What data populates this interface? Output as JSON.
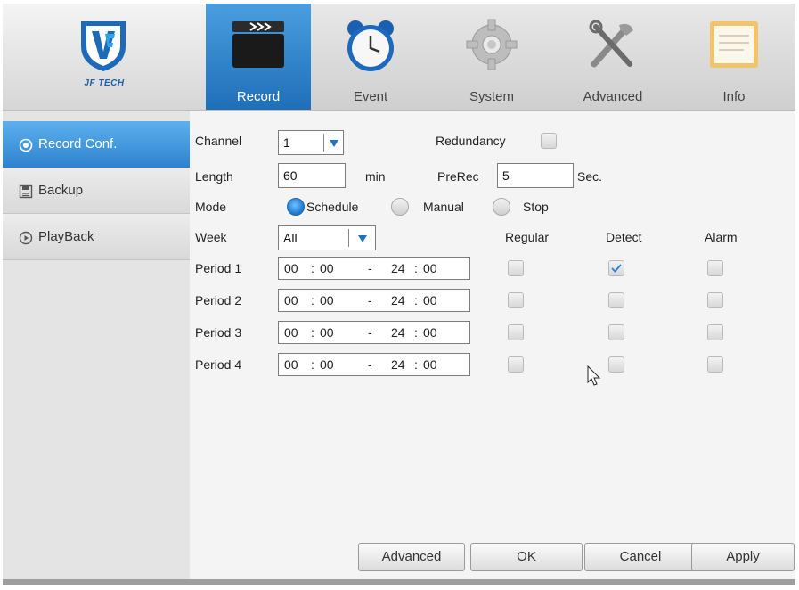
{
  "branding": {
    "logo_text": "JF TECH"
  },
  "tabs": [
    {
      "label": "Record",
      "icon": "clapperboard-icon",
      "active": true
    },
    {
      "label": "Event",
      "icon": "alarm-clock-icon",
      "active": false
    },
    {
      "label": "System",
      "icon": "gear-icon",
      "active": false
    },
    {
      "label": "Advanced",
      "icon": "tools-icon",
      "active": false
    },
    {
      "label": "Info",
      "icon": "document-icon",
      "active": false
    }
  ],
  "sidebar": {
    "items": [
      {
        "label": "Record Conf.",
        "icon": "record-circle-icon",
        "active": true
      },
      {
        "label": "Backup",
        "icon": "disk-icon",
        "active": false
      },
      {
        "label": "PlayBack",
        "icon": "play-circle-icon",
        "active": false
      }
    ]
  },
  "form": {
    "channel_label": "Channel",
    "channel_value": "1",
    "redundancy_label": "Redundancy",
    "redundancy_checked": false,
    "length_label": "Length",
    "length_value": "60",
    "length_unit": "min",
    "prerec_label": "PreRec",
    "prerec_value": "5",
    "prerec_unit": "Sec.",
    "mode_label": "Mode",
    "mode_options": [
      "Schedule",
      "Manual",
      "Stop"
    ],
    "mode_selected": "Schedule",
    "week_label": "Week",
    "week_value": "All",
    "col_regular": "Regular",
    "col_detect": "Detect",
    "col_alarm": "Alarm",
    "periods": [
      {
        "label": "Period 1",
        "start_h": "00",
        "start_m": "00",
        "end_h": "24",
        "end_m": "00",
        "regular": false,
        "detect": true,
        "alarm": false
      },
      {
        "label": "Period 2",
        "start_h": "00",
        "start_m": "00",
        "end_h": "24",
        "end_m": "00",
        "regular": false,
        "detect": false,
        "alarm": false
      },
      {
        "label": "Period 3",
        "start_h": "00",
        "start_m": "00",
        "end_h": "24",
        "end_m": "00",
        "regular": false,
        "detect": false,
        "alarm": false
      },
      {
        "label": "Period 4",
        "start_h": "00",
        "start_m": "00",
        "end_h": "24",
        "end_m": "00",
        "regular": false,
        "detect": false,
        "alarm": false
      }
    ],
    "time_sep": ":",
    "range_sep": "-"
  },
  "buttons": {
    "advanced": "Advanced",
    "ok": "OK",
    "cancel": "Cancel",
    "apply": "Apply"
  },
  "colors": {
    "accent": "#2d82cc",
    "checkmark": "#2a7fd4"
  }
}
